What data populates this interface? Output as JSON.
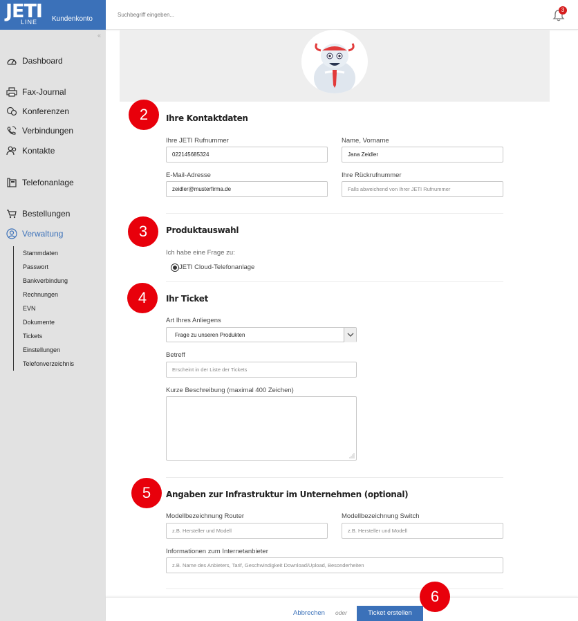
{
  "header": {
    "logo_text": "JETI",
    "logo_sub": "LINE",
    "brand_label": "Kundenkonto",
    "search_placeholder": "Suchbegriff eingeben...",
    "notification_count": "3",
    "bell_icon": "bell-icon"
  },
  "sidebar": {
    "items": [
      {
        "label": "Dashboard",
        "icon": "dashboard-icon"
      },
      {
        "label": "Fax-Journal",
        "icon": "printer-icon"
      },
      {
        "label": "Konferenzen",
        "icon": "conference-icon"
      },
      {
        "label": "Verbindungen",
        "icon": "phone-icon"
      },
      {
        "label": "Kontakte",
        "icon": "contacts-icon"
      },
      {
        "label": "Telefonanlage",
        "icon": "telephone-system-icon"
      },
      {
        "label": "Bestellungen",
        "icon": "cart-icon"
      },
      {
        "label": "Verwaltung",
        "icon": "user-circle-icon"
      }
    ],
    "subitems": [
      "Stammdaten",
      "Passwort",
      "Bankverbindung",
      "Rechnungen",
      "EVN",
      "Dokumente",
      "Tickets",
      "Einstellungen",
      "Telefonverzeichnis"
    ],
    "active_color": "#3b71b9"
  },
  "steps": [
    "2",
    "3",
    "4",
    "5",
    "6"
  ],
  "contact": {
    "title": "Ihre Kontaktdaten",
    "rufnummer_label": "Ihre JETI Rufnummer",
    "rufnummer_value": "022145685324",
    "name_label": "Name, Vorname",
    "name_value": "Jana Zeidler",
    "email_label": "E-Mail-Adresse",
    "email_value": "zeidler@musterfirma.de",
    "rueckruf_label": "Ihre Rückrufnummer",
    "rueckruf_placeholder": "Falls abweichend von Ihrer JETI Rufnummer"
  },
  "product": {
    "title": "Produktauswahl",
    "question": "Ich habe eine Frage zu:",
    "option": "JETI Cloud-Telefonanlage"
  },
  "ticket": {
    "title": "Ihr Ticket",
    "type_label": "Art Ihres Anliegens",
    "type_value": "Frage zu unseren Produkten",
    "subject_label": "Betreff",
    "subject_placeholder": "Erscheint in der Liste der Tickets",
    "desc_label": "Kurze Beschreibung (maximal 400 Zeichen)"
  },
  "infra": {
    "title": "Angaben zur Infrastruktur im Unternehmen (optional)",
    "router_label": "Modellbezeichnung Router",
    "router_placeholder": "z.B. Hersteller und Modell",
    "switch_label": "Modellbezeichnung Switch",
    "switch_placeholder": "z.B. Hersteller und Modell",
    "isp_label": "Informationen zum Internetanbieter",
    "isp_placeholder": "z.B. Name des Anbieters, Tarif, Geschwindigkeit Download/Upload, Besonderheiten"
  },
  "footer": {
    "cancel": "Abbrechen",
    "or": "oder",
    "submit": "Ticket erstellen"
  }
}
